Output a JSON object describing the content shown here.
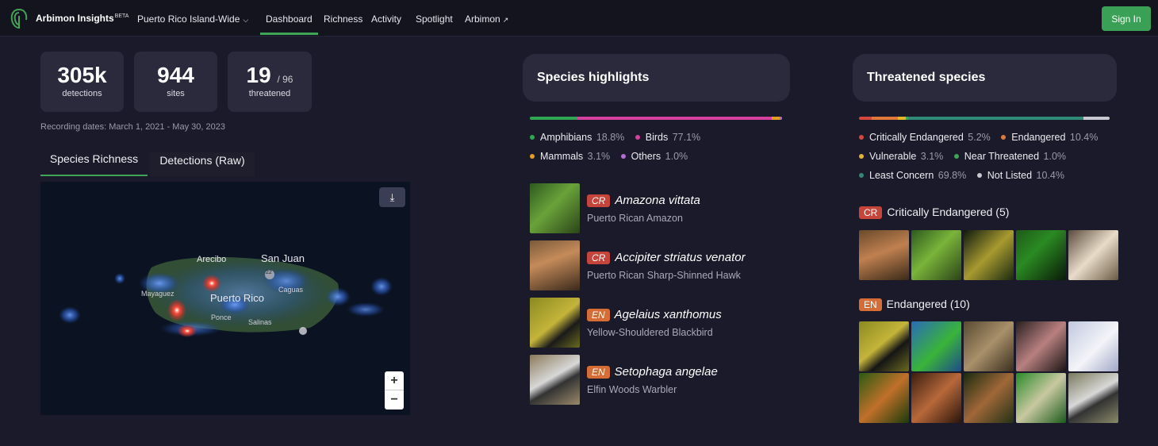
{
  "nav": {
    "brand": "Arbimon Insights",
    "brand_sup": "BETA",
    "project": "Puerto Rico Island-Wide",
    "links": [
      "Dashboard",
      "Richness",
      "Activity",
      "Spotlight",
      "Arbimon"
    ],
    "active_link": "Dashboard",
    "signin": "Sign In"
  },
  "stats": [
    {
      "value": "305k",
      "label": "detections"
    },
    {
      "value": "944",
      "label": "sites"
    },
    {
      "value": "19",
      "suffix": "/ 96",
      "label": "threatened"
    }
  ],
  "recording_dates": "Recording dates: March 1, 2021 - May 30, 2023",
  "tabs": [
    "Species Richness",
    "Detections (Raw)"
  ],
  "map": {
    "labels": [
      "Arecibo",
      "San Juan",
      "Mayaguez",
      "Puerto Rico",
      "Caguas",
      "Ponce",
      "Salinas",
      "22"
    ],
    "zoom_in": "+",
    "zoom_out": "−"
  },
  "highlights": {
    "title": "Species highlights",
    "taxa": [
      {
        "name": "Amphibians",
        "pct": "18.8%",
        "value": 18.8,
        "color": "#2fa652"
      },
      {
        "name": "Birds",
        "pct": "77.1%",
        "value": 77.1,
        "color": "#d6409f"
      },
      {
        "name": "Mammals",
        "pct": "3.1%",
        "value": 3.1,
        "color": "#e0a020"
      },
      {
        "name": "Others",
        "pct": "1.0%",
        "value": 1.0,
        "color": "#b76ad8"
      }
    ],
    "species": [
      {
        "status": "CR",
        "scientific": "Amazona vittata",
        "common": "Puerto Rican Amazon",
        "image": "green-parrot"
      },
      {
        "status": "CR",
        "scientific": "Accipiter striatus venator",
        "common": "Puerto Rican Sharp-Shinned Hawk",
        "image": "hawk"
      },
      {
        "status": "EN",
        "scientific": "Agelaius xanthomus",
        "common": "Yellow-Shouldered Blackbird",
        "image": "blackbird"
      },
      {
        "status": "EN",
        "scientific": "Setophaga angelae",
        "common": "Elfin Woods Warbler",
        "image": "warbler"
      }
    ]
  },
  "threatened": {
    "title": "Threatened species",
    "categories": [
      {
        "name": "Critically Endangered",
        "pct": "5.2%",
        "value": 5.2,
        "color": "#d4473a"
      },
      {
        "name": "Endangered",
        "pct": "10.4%",
        "value": 10.4,
        "color": "#e0783a"
      },
      {
        "name": "Vulnerable",
        "pct": "3.1%",
        "value": 3.1,
        "color": "#e6b42a"
      },
      {
        "name": "Near Threatened",
        "pct": "1.0%",
        "value": 1.0,
        "color": "#3fa455"
      },
      {
        "name": "Least Concern",
        "pct": "69.8%",
        "value": 69.8,
        "color": "#2f8a78"
      },
      {
        "name": "Not Listed",
        "pct": "10.4%",
        "value": 10.4,
        "color": "#c8c8d0"
      }
    ],
    "cr_badge": "CR",
    "cr_heading": "Critically Endangered (5)",
    "en_badge": "EN",
    "en_heading": "Endangered (10)",
    "cr_images": [
      "hawk",
      "green-parrot",
      "frog-dark",
      "frog-leaf",
      "frog-pale"
    ],
    "en_images": [
      "blackbird",
      "parrot-blue",
      "toad",
      "frog-pink",
      "bird-white",
      "frog-orange",
      "frog-brown",
      "frog-leaf-brown",
      "frog-green",
      "warbler"
    ]
  }
}
